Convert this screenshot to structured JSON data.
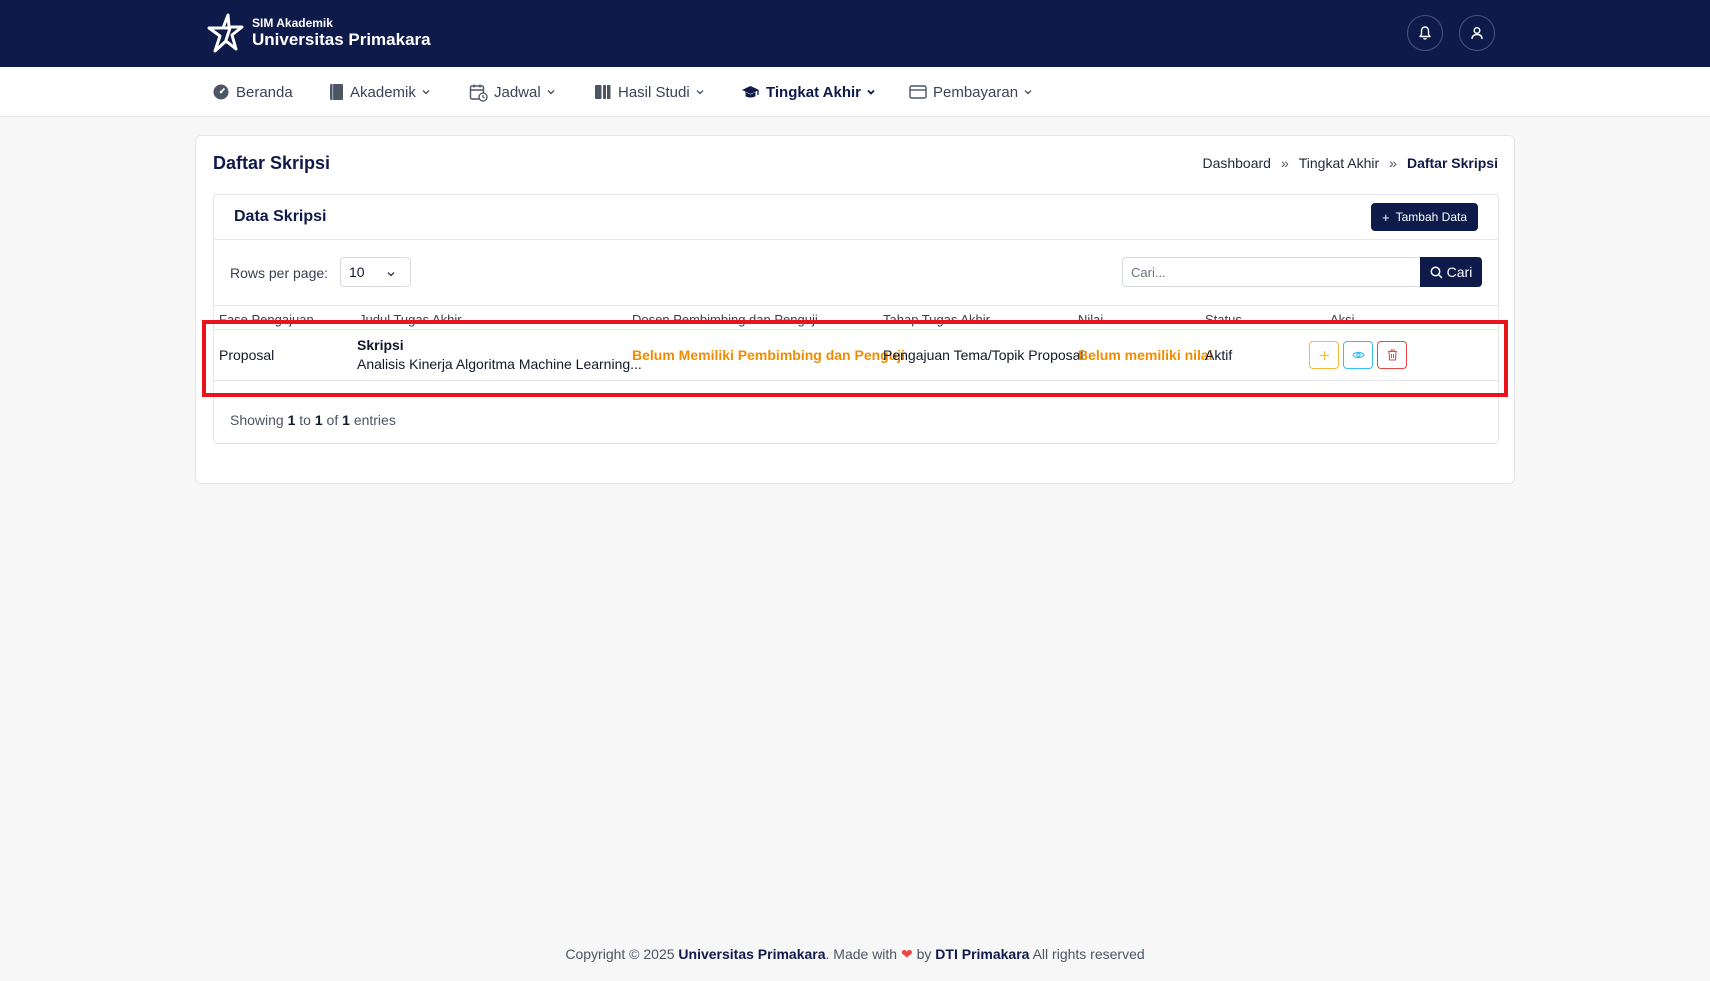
{
  "header": {
    "brand_sub": "SIM Akademik",
    "brand_title": "Universitas Primakara",
    "icons": [
      "bell-icon",
      "user-icon"
    ]
  },
  "nav": {
    "beranda": "Beranda",
    "akademik": "Akademik",
    "jadwal": "Jadwal",
    "hasil_studi": "Hasil Studi",
    "tingkat_akhir": "Tingkat Akhir",
    "pembayaran": "Pembayaran"
  },
  "page": {
    "title": "Daftar Skripsi",
    "breadcrumb": [
      "Dashboard",
      "Tingkat Akhir",
      "Daftar Skripsi"
    ],
    "breadcrumb_sep": "»"
  },
  "panel": {
    "title": "Data Skripsi",
    "add_label": "Tambah Data",
    "rows_label": "Rows per page:",
    "rows_value": "10",
    "search_placeholder": "Cari...",
    "search_label": "Cari"
  },
  "table": {
    "columns": [
      "Fase Pengajuan",
      "Judul Tugas Akhir",
      "Dosen Pembimbing dan Penguji",
      "Tahap Tugas Akhir",
      "Nilai",
      "Status",
      "Aksi"
    ],
    "rows": [
      {
        "fase": "Proposal",
        "judul_type": "Skripsi",
        "judul_title": "Analisis Kinerja Algoritma Machine Learning...",
        "dosen": "Belum Memiliki Pembimbing dan Penguji",
        "tahap": "Pengajuan Tema/Topik Proposal",
        "nilai": "Belum memiliki nilai",
        "status": "Aktif"
      }
    ]
  },
  "pagination": {
    "showing": "Showing",
    "from": "1",
    "to_word": "to",
    "to": "1",
    "of_word": "of",
    "total": "1",
    "entries": "entries"
  },
  "footer": {
    "copyright": "Copyright © 2025",
    "university": "Universitas Primakara",
    "made_with": ". Made with",
    "by": "by",
    "dti": "DTI Primakara",
    "rights": "All rights reserved"
  },
  "colors": {
    "navy": "#0e1a4a",
    "warning": "#f08c00",
    "highlight": "#e8141c"
  }
}
